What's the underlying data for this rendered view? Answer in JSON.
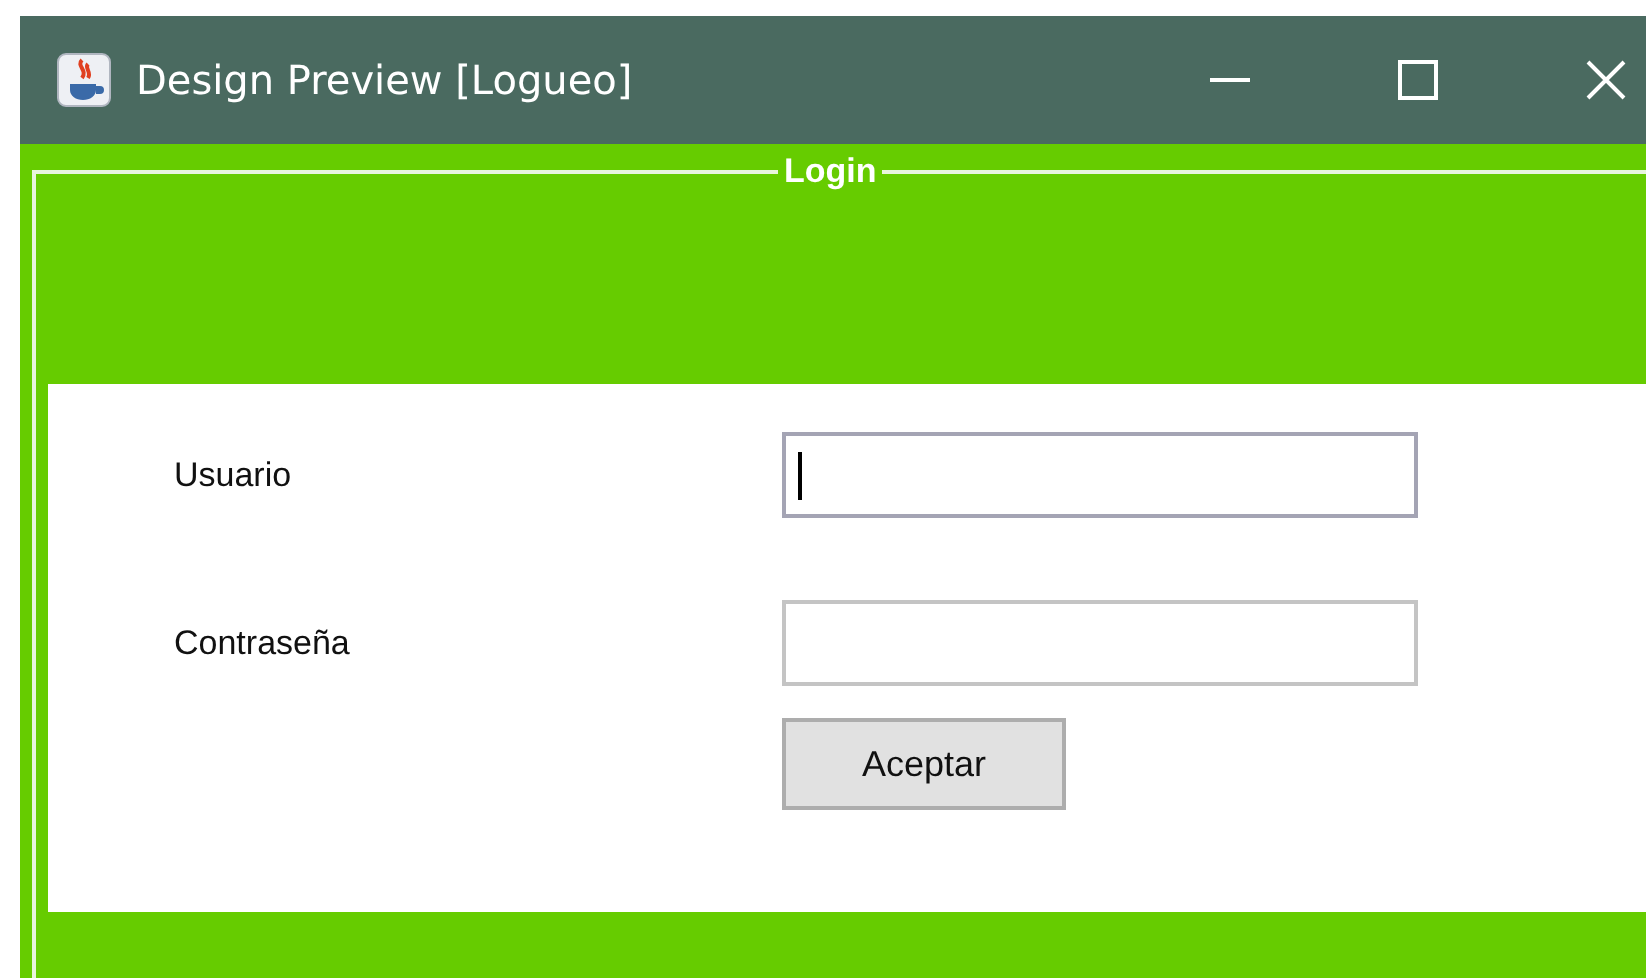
{
  "window": {
    "title": "Design Preview [Logueo]"
  },
  "panel": {
    "title": "Login"
  },
  "fields": [
    {
      "label": "Usuario",
      "focused": true
    },
    {
      "label": "Contraseña",
      "focused": false
    }
  ],
  "buttons": [
    "Aceptar"
  ]
}
